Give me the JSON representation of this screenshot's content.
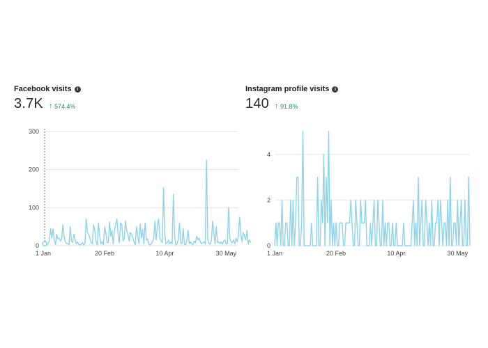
{
  "panels": [
    {
      "title": "Facebook visits",
      "value": "3.7K",
      "change": "574.4%",
      "change_direction": "up"
    },
    {
      "title": "Instagram profile visits",
      "value": "140",
      "change": "91.8%",
      "change_direction": "up"
    }
  ],
  "colors": {
    "line": "#8dd3ee",
    "grid": "#e6e6e6",
    "positive": "#2e8b57"
  },
  "chart_data": [
    {
      "type": "line",
      "x_tick_labels": [
        "1 Jan",
        "20 Feb",
        "10 Apr",
        "30 May"
      ],
      "x_tick_days": [
        0,
        50,
        99,
        149
      ],
      "y_tick_labels": [
        "0",
        "100",
        "200",
        "300"
      ],
      "ylim": [
        0,
        300
      ],
      "x_days": 160,
      "grid": true,
      "series": [
        {
          "values": [
            5,
            8,
            12,
            2,
            6,
            14,
            45,
            20,
            44,
            15,
            3,
            30,
            18,
            20,
            12,
            18,
            55,
            25,
            10,
            5,
            6,
            2,
            50,
            12,
            8,
            30,
            15,
            5,
            10,
            3,
            2,
            4,
            8,
            2,
            6,
            70,
            35,
            30,
            20,
            8,
            5,
            55,
            40,
            12,
            2,
            60,
            25,
            5,
            10,
            3,
            50,
            35,
            8,
            8,
            62,
            25,
            40,
            5,
            38,
            55,
            70,
            28,
            8,
            60,
            55,
            12,
            20,
            65,
            40,
            30,
            12,
            35,
            30,
            20,
            10,
            2,
            50,
            25,
            5,
            58,
            20,
            42,
            5,
            60,
            15,
            18,
            4,
            2,
            6,
            10,
            20,
            65,
            15,
            55,
            70,
            20,
            12,
            8,
            153,
            30,
            5,
            8,
            15,
            5,
            10,
            5,
            135,
            25,
            2,
            5,
            15,
            60,
            8,
            5,
            45,
            4,
            2,
            15,
            40,
            5,
            10,
            5,
            2,
            12,
            8,
            25,
            15,
            20,
            10,
            5,
            8,
            10,
            4,
            225,
            20,
            6,
            4,
            15,
            65,
            30,
            5,
            50,
            8,
            10,
            5,
            10,
            4,
            12,
            15,
            5,
            5,
            100,
            20,
            10,
            8,
            15,
            5,
            20,
            10,
            25,
            75,
            30,
            10,
            35,
            25,
            15,
            40,
            5,
            15,
            8
          ]
        }
      ]
    },
    {
      "type": "line",
      "x_tick_labels": [
        "1 Jan",
        "20 Feb",
        "10 Apr",
        "30 May"
      ],
      "x_tick_days": [
        0,
        50,
        99,
        149
      ],
      "y_tick_labels": [
        "0",
        "2",
        "4"
      ],
      "ylim": [
        0,
        5
      ],
      "x_days": 160,
      "grid": true,
      "series": [
        {
          "values": [
            0,
            1,
            0,
            1,
            1,
            0,
            2,
            0,
            0,
            1,
            1,
            0,
            0,
            2,
            0,
            2,
            0,
            1,
            3,
            3,
            0,
            0,
            1,
            5,
            0,
            0,
            0,
            0,
            0,
            0,
            1,
            0,
            0,
            0,
            0,
            3,
            0,
            0,
            2,
            1,
            4,
            0,
            3,
            1,
            5,
            0,
            2,
            0,
            1,
            0,
            1,
            0,
            0,
            1,
            1,
            1,
            0,
            0,
            1,
            1,
            1,
            1,
            2,
            1,
            0,
            0,
            2,
            1,
            0,
            0,
            2,
            1,
            1,
            1,
            2,
            0,
            0,
            0,
            1,
            0,
            1,
            2,
            0,
            0,
            2,
            1,
            0,
            0,
            2,
            0,
            1,
            0,
            1,
            1,
            0,
            0,
            1,
            0,
            0,
            1,
            0,
            0,
            0,
            0,
            0,
            1,
            0,
            0,
            0,
            0,
            0,
            0,
            1,
            2,
            0,
            1,
            0,
            3,
            0,
            1,
            2,
            0,
            0,
            2,
            1,
            0,
            1,
            0,
            2,
            0,
            0,
            1,
            1,
            2,
            0,
            2,
            1,
            0,
            1,
            1,
            0,
            2,
            0,
            3,
            0,
            0,
            1,
            1,
            0,
            2,
            0,
            1,
            2,
            0,
            0,
            2,
            0,
            0,
            3,
            0
          ]
        }
      ]
    }
  ]
}
